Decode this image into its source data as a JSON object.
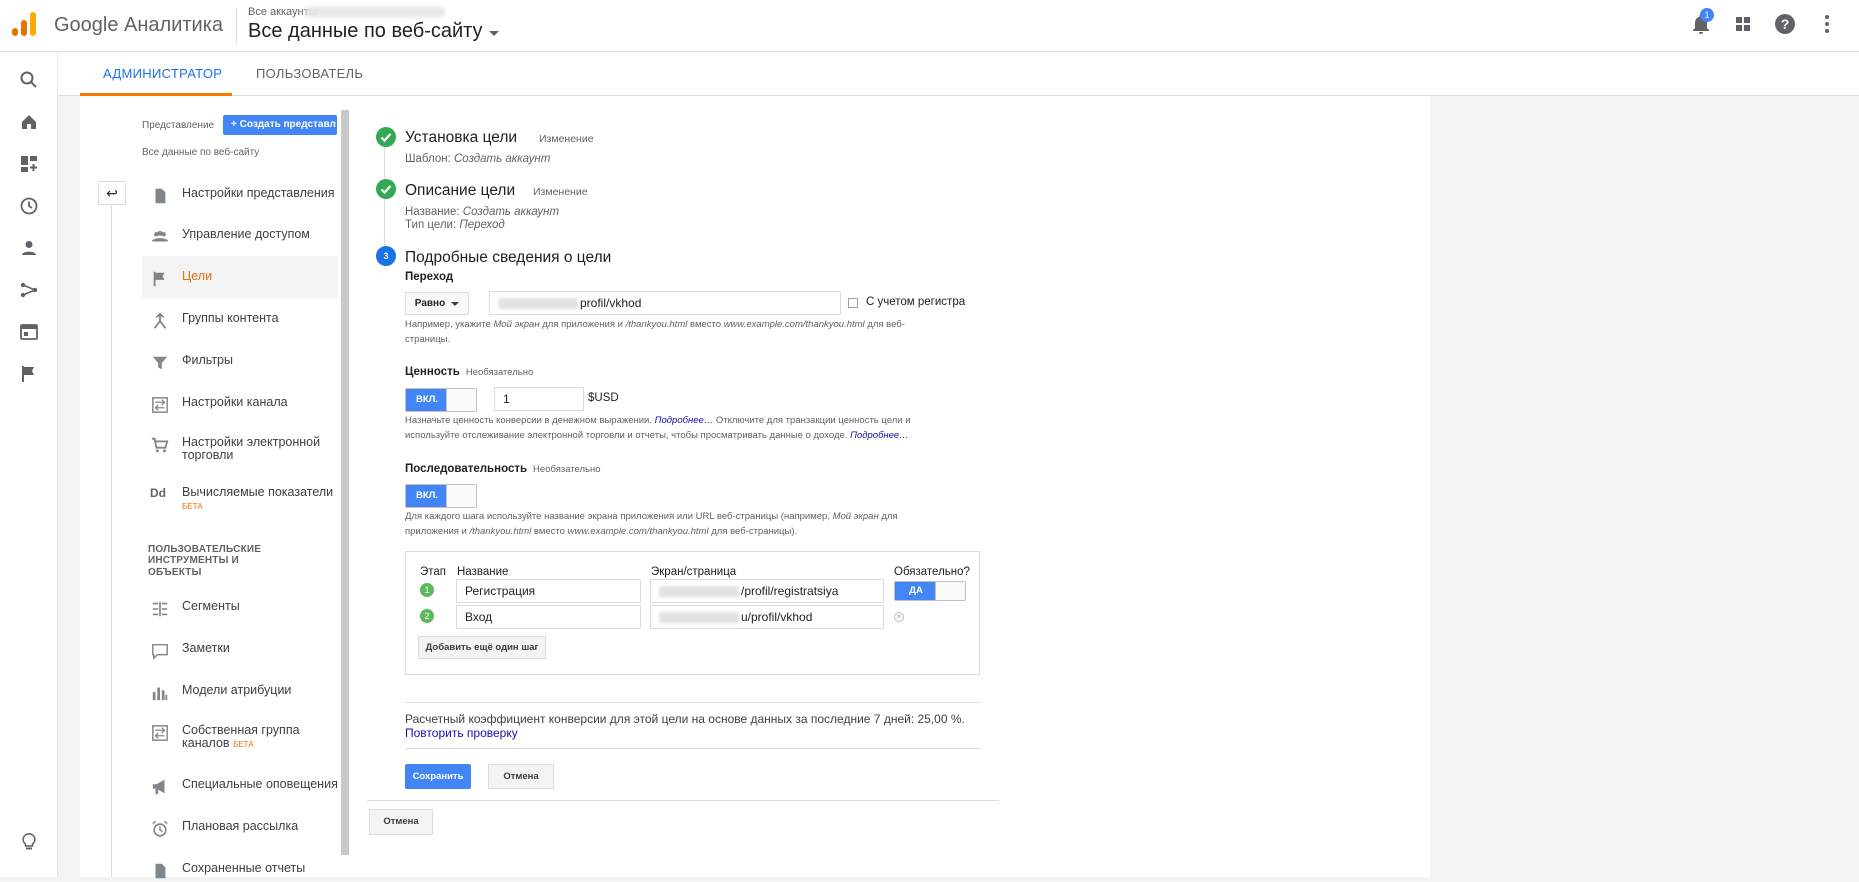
{
  "header": {
    "brand": "Google Аналитика",
    "crumb": "Все аккаунты",
    "view": "Все данные по веб-сайту",
    "notif_count": "1"
  },
  "tabs": {
    "admin": "АДМИНИСТРАТОР",
    "user": "ПОЛЬЗОВАТЕЛЬ"
  },
  "panel": {
    "view_label": "Представление",
    "create_label": "+ Создать представл",
    "view_name": "Все данные по веб-сайту",
    "items": [
      {
        "label": "Настройки представления"
      },
      {
        "label": "Управление доступом"
      },
      {
        "label": "Цели"
      },
      {
        "label": "Группы контента"
      },
      {
        "label": "Фильтры"
      },
      {
        "label": "Настройки канала"
      },
      {
        "label": "Настройки электронной торговли"
      },
      {
        "label": "Вычисляемые показатели",
        "badge": "БЕТА"
      },
      {
        "label": "Сегменты"
      },
      {
        "label": "Заметки"
      },
      {
        "label": "Модели атрибуции"
      },
      {
        "label": "Собственная группа каналов",
        "badge": "БЕТА"
      },
      {
        "label": "Специальные оповещения"
      },
      {
        "label": "Плановая рассылка"
      },
      {
        "label": "Сохраненные отчеты"
      }
    ],
    "group_label_1": "ПОЛЬЗОВАТЕЛЬСКИЕ ИНСТРУМЕНТЫ И",
    "group_label_2": "ОБЪЕКТЫ"
  },
  "goal": {
    "step1_title": "Установка цели",
    "step1_change": "Изменение",
    "step1_sub_label": "Шаблон:",
    "step1_sub_value": "Создать аккаунт",
    "step2_title": "Описание цели",
    "step2_change": "Изменение",
    "step2_name_label": "Название:",
    "step2_name_value": "Создать аккаунт",
    "step2_type_label": "Тип цели:",
    "step2_type_value": "Переход",
    "step3_num": "3",
    "step3_title": "Подробные сведения о цели",
    "dest_label": "Переход",
    "match_type": "Равно",
    "dest_value": "profil/vkhod",
    "case_label": "С учетом регистра",
    "dest_hint_1": "Например, укажите",
    "dest_hint_i1": "Мой экран",
    "dest_hint_2": "для приложения и",
    "dest_hint_i2": "/thankyou.html",
    "dest_hint_3": "вместо",
    "dest_hint_i3": "www.example.com/thankyou.html",
    "dest_hint_4": "для веб-",
    "dest_hint_5": "страницы.",
    "value_label": "Ценность",
    "value_optional": "Необязательно",
    "value_toggle": "ВКЛ.",
    "value_amount": "1",
    "value_currency": "$USD",
    "value_hint_1": "Назначьте ценность конверсии в денежном выражении.",
    "value_hint_link1": "Подробнее…",
    "value_hint_2": "Отключите для транзакции ценность цели и",
    "value_hint_3": "используйте отслеживание электронной торговли и отчеты, чтобы просматривать данные о доходе.",
    "value_hint_link2": "Подробнее…",
    "funnel_label": "Последовательность",
    "funnel_optional": "Необязательно",
    "funnel_toggle": "ВКЛ.",
    "funnel_hint_1": "Для каждого шага используйте название экрана приложения или URL веб-страницы (например,",
    "funnel_hint_i1": "Мой экран",
    "funnel_hint_2": "для",
    "funnel_hint_3": "приложения и",
    "funnel_hint_i2": "/thankyou.html",
    "funnel_hint_4": "вместо",
    "funnel_hint_i3": "www.example.com/thankyou.html",
    "funnel_hint_5": "для веб-страницы).",
    "col_step": "Этап",
    "col_name": "Название",
    "col_screen": "Экран/страница",
    "col_required": "Обязательно?",
    "steps": [
      {
        "num": "1",
        "name": "Регистрация",
        "page": "/profil/registratsiya",
        "required": "ДА"
      },
      {
        "num": "2",
        "name": "Вход",
        "page": "u/profil/vkhod"
      }
    ],
    "add_step": "Добавить ещё один шаг",
    "conv_text": "Расчетный коэффициент конверсии для этой цели на основе данных за последние 7 дней: 25,00 %.",
    "retry": "Повторить проверку",
    "save": "Сохранить",
    "cancel": "Отмена",
    "cancel_outer": "Отмена"
  },
  "colors": {
    "accent": "#4285f4",
    "orange": "#e8710a",
    "green": "#34a853"
  },
  "icons": [
    "search-icon",
    "home-icon",
    "customization-icon",
    "clock-icon",
    "person-icon",
    "acquisition-icon",
    "behavior-icon",
    "flag-icon",
    "lightbulb-icon",
    "bell-icon",
    "apps-icon",
    "help-icon",
    "more-icon"
  ]
}
